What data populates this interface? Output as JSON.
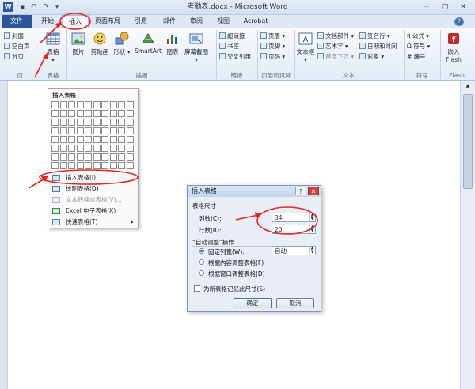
{
  "titlebar": {
    "title": "考勤表.docx - Microsoft Word",
    "app_icon": "W"
  },
  "tabs": [
    "文件",
    "开始",
    "插入",
    "页面布局",
    "引用",
    "邮件",
    "审阅",
    "视图",
    "Acrobat"
  ],
  "ribbon": {
    "pages": {
      "cover": "封面",
      "blank": "空白页",
      "break": "分页",
      "label": "页"
    },
    "table": {
      "button": "表格",
      "label": "表格"
    },
    "illustrations": {
      "picture": "图片",
      "clipart": "剪贴画",
      "shapes": "形状",
      "smartart": "SmartArt",
      "chart": "图表",
      "screenshot": "屏幕截图",
      "label": "插图"
    },
    "links": {
      "hyperlink": "超链接",
      "bookmark": "书签",
      "crossref": "交叉引用",
      "label": "链接"
    },
    "header_footer": {
      "header": "页眉",
      "footer": "页脚",
      "page_number": "页码",
      "label": "页眉和页脚"
    },
    "text": {
      "textbox": "文本框",
      "quickparts": "文档部件",
      "wordart": "艺术字",
      "dropcap": "首字下沉",
      "signature": "签名行",
      "datetime": "日期和时间",
      "object": "对象",
      "label": "文本"
    },
    "symbols": {
      "equation": "公式",
      "symbol": "符号",
      "number": "编号",
      "label": "符号"
    },
    "flash": {
      "embed": "嵌入",
      "flash": "Flash",
      "label": "Flash"
    }
  },
  "menu": {
    "grid_title": "插入表格",
    "items": [
      "插入表格(I)...",
      "绘制表格(D)",
      "文本转换成表格(V)...",
      "Excel 电子表格(X)",
      "快速表格(T)"
    ]
  },
  "dialog": {
    "title": "插入表格",
    "help": "?",
    "close": "✕",
    "size_section": "表格尺寸",
    "columns_label": "列数(C):",
    "columns_value": "34",
    "rows_label": "行数(R):",
    "rows_value": "20",
    "autofit_section": "“自动调整”操作",
    "fixed_width": "固定列宽(W):",
    "fixed_width_value": "自动",
    "fit_content": "根据内容调整表格(F)",
    "fit_window": "根据窗口调整表格(D)",
    "remember": "为新表格记忆此尺寸(S)",
    "ok": "确定",
    "cancel": "取消"
  },
  "colors": {
    "annotation": "#e8231f",
    "file_tab": "#2b579a"
  }
}
